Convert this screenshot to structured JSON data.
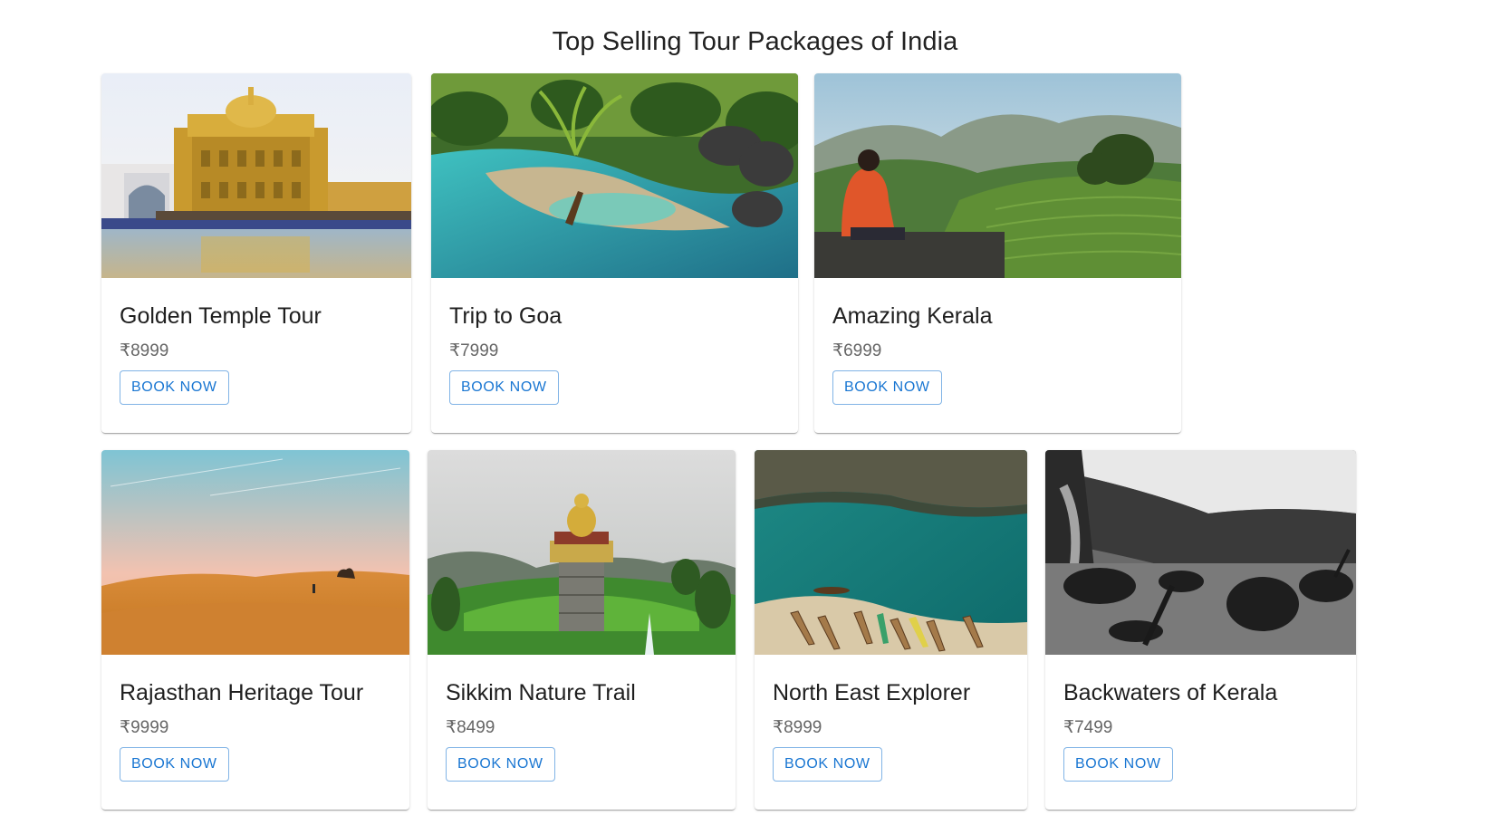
{
  "page": {
    "title": "Top Selling Tour Packages of India"
  },
  "cards": [
    {
      "title": "Golden Temple Tour",
      "price": "₹8999",
      "button": "BOOK NOW",
      "image": "golden-temple-photo"
    },
    {
      "title": "Trip to Goa",
      "price": "₹7999",
      "button": "BOOK NOW",
      "image": "goa-lagoon-photo"
    },
    {
      "title": "Amazing Kerala",
      "price": "₹6999",
      "button": "BOOK NOW",
      "image": "kerala-hills-photo"
    },
    {
      "title": "Rajasthan Heritage Tour",
      "price": "₹9999",
      "button": "BOOK NOW",
      "image": "rajasthan-desert-photo"
    },
    {
      "title": "Sikkim Nature Trail",
      "price": "₹8499",
      "button": "BOOK NOW",
      "image": "sikkim-buddha-photo"
    },
    {
      "title": "North East Explorer",
      "price": "₹8999",
      "button": "BOOK NOW",
      "image": "northeast-river-photo"
    },
    {
      "title": "Backwaters of Kerala",
      "price": "₹7499",
      "button": "BOOK NOW",
      "image": "backwaters-photo"
    }
  ],
  "theme": {
    "accent": "#1976d2",
    "price_color": "#666666"
  }
}
